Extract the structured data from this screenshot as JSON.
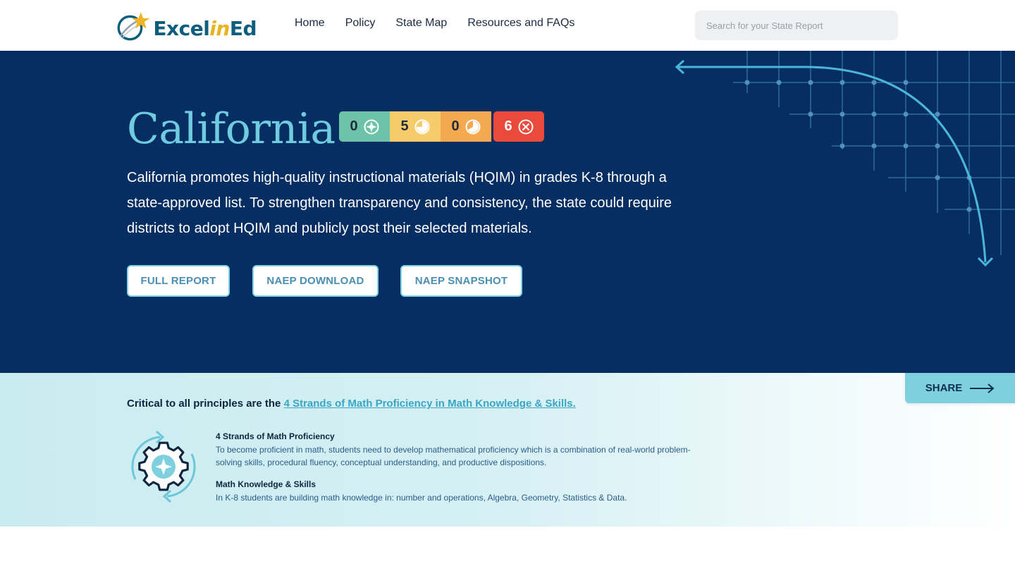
{
  "header": {
    "logo": {
      "prefix": "Excel",
      "mid": "in",
      "suffix": "Ed"
    },
    "nav": [
      "Home",
      "Policy",
      "State Map",
      "Resources and FAQs"
    ],
    "search_placeholder": "Search for your State Report"
  },
  "hero": {
    "title": "California",
    "badges": [
      {
        "count": "0",
        "icon": "compass-icon",
        "color": "#6cc3a8"
      },
      {
        "count": "5",
        "icon": "pie-three-quarter-icon",
        "color": "#f6cc6a"
      },
      {
        "count": "0",
        "icon": "pie-half-icon",
        "color": "#f3a94f"
      },
      {
        "count": "6",
        "icon": "x-circle-icon",
        "color": "#ea4a3c"
      }
    ],
    "description": "California promotes high-quality instructional materials (HQIM) in grades K-8 through a state-approved list. To strengthen transparency and consistency, the state could require districts to adopt HQIM and publicly post their selected materials.",
    "buttons": [
      "FULL REPORT",
      "NAEP DOWNLOAD",
      "NAEP SNAPSHOT"
    ]
  },
  "strands": {
    "share_label": "SHARE",
    "critical_prefix": "Critical to all principles are the ",
    "critical_link": "4 Strands of Math Proficiency in Math Knowledge & Skills.",
    "blocks": [
      {
        "title": "4 Strands of Math Proficiency",
        "text": "To become proficient in math, students need to develop mathematical proficiency which is a combination of real-world problem-solving skills, procedural fluency, conceptual understanding, and productive dispositions."
      },
      {
        "title": "Math Knowledge & Skills",
        "text": "In K-8 students are building math knowledge in: number and operations, Algebra, Geometry, Statistics & Data."
      }
    ]
  },
  "colors": {
    "hero_bg": "#062e62",
    "accent": "#6fcbe0",
    "link": "#3aa6c4"
  }
}
